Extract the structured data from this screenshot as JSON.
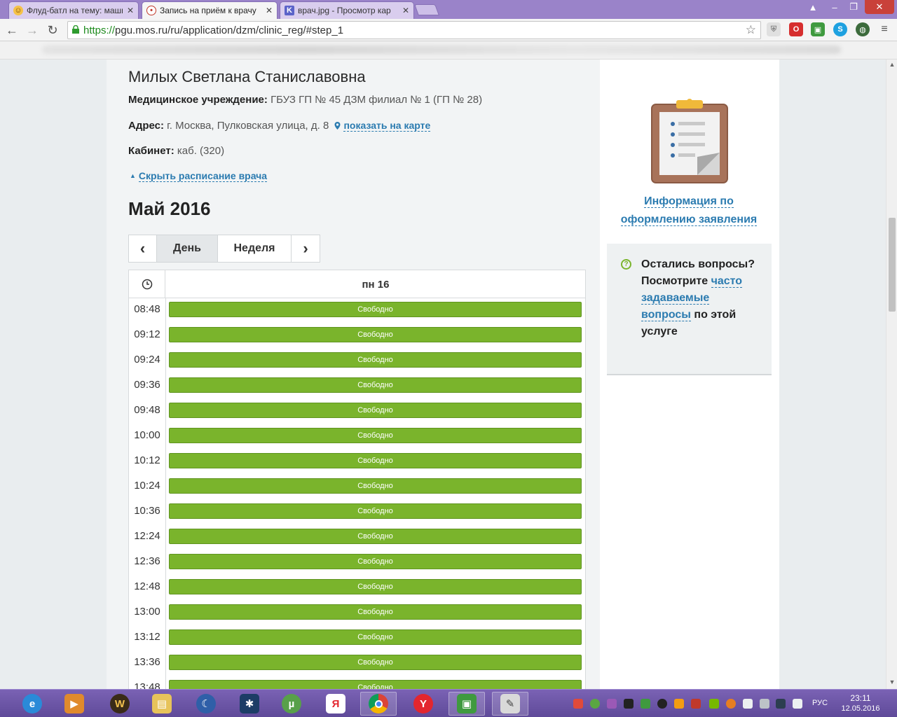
{
  "browser": {
    "tabs": [
      {
        "title": "Флуд-батл на тему: маши",
        "icon": "forum-icon",
        "active": false
      },
      {
        "title": "Запись на приём к врачу",
        "icon": "pgu-icon",
        "active": true
      },
      {
        "title": "врач.jpg - Просмотр кар",
        "icon": "image-viewer-icon",
        "active": false
      }
    ],
    "url_scheme": "https://",
    "url_rest": "pgu.mos.ru/ru/application/dzm/clinic_reg/#step_1",
    "extensions": [
      "opera-badge-icon",
      "robot-icon",
      "skype-icon",
      "globe-icon",
      "menu-icon"
    ]
  },
  "doctor": {
    "name": "Милых Светлана Станиславовна",
    "institution_label": "Медицинское учреждение:",
    "institution_value": "ГБУЗ ГП № 45 ДЗМ филиал № 1 (ГП № 28)",
    "address_label": "Адрес:",
    "address_value": "г. Москва, Пулковская улица, д. 8",
    "map_link": "показать на карте",
    "cabinet_label": "Кабинет:",
    "cabinet_value": "каб. (320)",
    "hide_schedule": "Скрыть расписание врача"
  },
  "schedule": {
    "month": "Май 2016",
    "view_day": "День",
    "view_week": "Неделя",
    "prev": "‹",
    "next": "›",
    "day_label": "пн 16",
    "slot_status": "Свободно",
    "slots": [
      "08:48",
      "09:12",
      "09:24",
      "09:36",
      "09:48",
      "10:00",
      "10:12",
      "10:24",
      "10:36",
      "12:24",
      "12:36",
      "12:48",
      "13:00",
      "13:12",
      "13:36",
      "13:48"
    ]
  },
  "sidebar": {
    "info_link": "Информация по оформлению заявления",
    "faq_prefix": "Остались вопросы? Посмотрите ",
    "faq_link": "часто задаваемые вопросы",
    "faq_suffix": " по этой услуге"
  },
  "taskbar": {
    "lang": "РУС",
    "time": "23:11",
    "date": "12.05.2016"
  },
  "colors": {
    "accent_green": "#7ab42c",
    "link_blue": "#2b7bb0",
    "taskbar_purple": "#6a53a6"
  }
}
